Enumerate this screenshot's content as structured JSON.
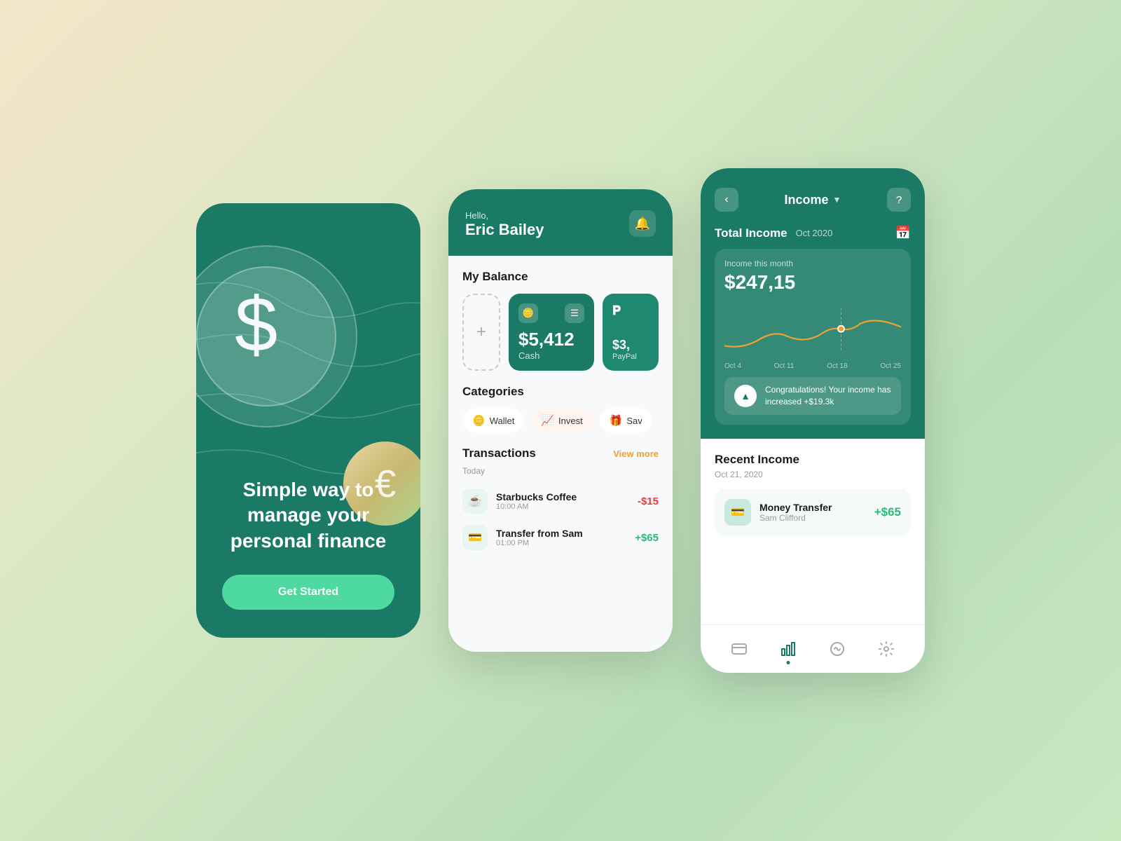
{
  "background": {
    "gradient": "linear-gradient(135deg, #f5e6c8 0%, #d4e8c2 40%, #b8ddb8 70%, #c8e8c0 100%)"
  },
  "phone1": {
    "tagline": "Simple way to manage your personal finance",
    "cta_label": "Get Started",
    "currency_main": "$",
    "currency_secondary": "€"
  },
  "phone2": {
    "greeting": "Hello,",
    "user_name": "Eric Bailey",
    "section_balance": "My Balance",
    "add_icon": "+",
    "cash_amount": "$5,412",
    "cash_label": "Cash",
    "paypal_amount": "$3,",
    "paypal_label": "PayPal",
    "section_categories": "Categories",
    "categories": [
      {
        "label": "Wallet",
        "icon": "🪙"
      },
      {
        "label": "Invest",
        "icon": "📈"
      },
      {
        "label": "Sav",
        "icon": "🎁"
      }
    ],
    "section_transactions": "Transactions",
    "view_more_label": "View more",
    "tx_date": "Today",
    "transactions": [
      {
        "name": "Starbucks Coffee",
        "time": "10:00 AM",
        "amount": "-$15",
        "type": "negative"
      },
      {
        "name": "Transfer from Sam",
        "time": "01:00 PM",
        "amount": "+$65",
        "type": "positive"
      }
    ]
  },
  "phone3": {
    "back_label": "<",
    "title": "Income",
    "help_label": "?",
    "total_income_label": "Total Income",
    "month_label": "Oct 2020",
    "chart_subtitle": "Income this month",
    "chart_amount": "$247,15",
    "chart_x_labels": [
      "Oct 4",
      "Oct 11",
      "Oct 18",
      "Oct 25"
    ],
    "congrats_text": "Congratulations! Your income has increased +$19.3k",
    "recent_income_title": "Recent Income",
    "recent_income_date": "Oct 21, 2020",
    "income_items": [
      {
        "name": "Money Transfer",
        "from": "Sam Clifford",
        "amount": "+$65"
      }
    ],
    "nav_items": [
      "card",
      "chart",
      "basket",
      "gear"
    ]
  }
}
